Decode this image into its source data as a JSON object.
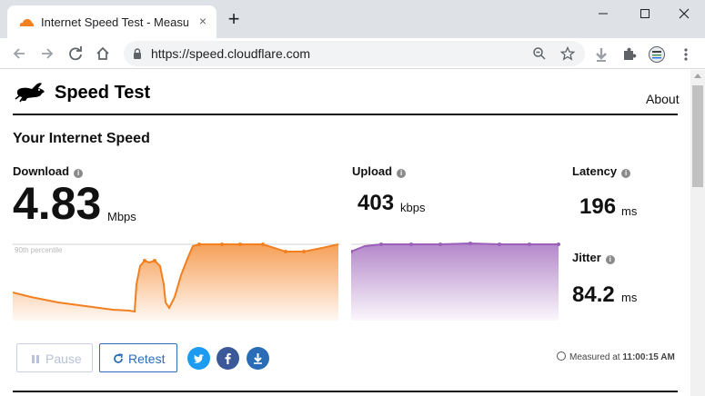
{
  "browser": {
    "tab_title": "Internet Speed Test - Measure",
    "tab_close": "×",
    "new_tab": "+",
    "url": "https://speed.cloudflare.com"
  },
  "header": {
    "brand": "Speed Test",
    "about_link": "About"
  },
  "main": {
    "section_title": "Your Internet Speed",
    "download": {
      "label": "Download",
      "value": "4.83",
      "unit": "Mbps"
    },
    "upload": {
      "label": "Upload",
      "value": "403",
      "unit": "kbps"
    },
    "latency": {
      "label": "Latency",
      "value": "196",
      "unit": "ms"
    },
    "jitter": {
      "label": "Jitter",
      "value": "84.2",
      "unit": "ms"
    },
    "percentile_label": "90th percentile",
    "info_glyph": "i"
  },
  "controls": {
    "pause_label": "Pause",
    "retest_label": "Retest",
    "measured_prefix": "Measured at",
    "measured_time": "11:00:15 AM"
  },
  "colors": {
    "download": "#f38020",
    "upload": "#9b5fb8",
    "twitter": "#1d9bf0",
    "facebook": "#3b5998",
    "share": "#2b6cb7"
  }
}
